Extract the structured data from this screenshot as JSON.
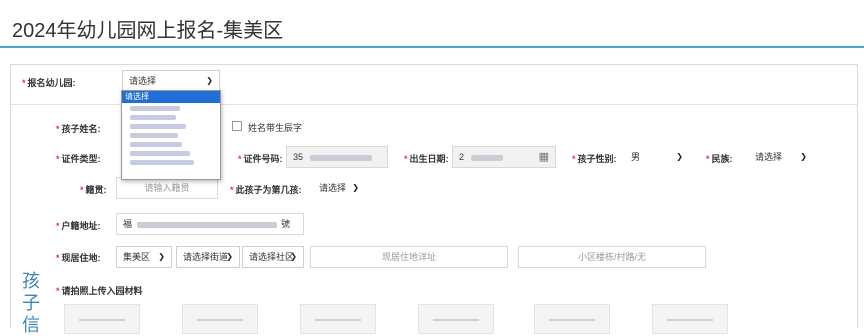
{
  "page": {
    "title": "2024年幼儿园网上报名-集美区"
  },
  "kindergarten": {
    "label": "报名幼儿园:",
    "required": "*",
    "select_value": "请选择",
    "options": [
      "请选择"
    ]
  },
  "child": {
    "section_label": "孩子信",
    "name": {
      "label": "孩子姓名:",
      "required": "*",
      "unborn_label": "姓名带生辰字"
    },
    "id_type": {
      "label": "证件类型:",
      "required": "*"
    },
    "id_number": {
      "label": "证件号码:",
      "required": "*",
      "value_prefix": "35"
    },
    "birth_date": {
      "label": "出生日期:",
      "required": "*",
      "value_prefix": "2"
    },
    "gender": {
      "label": "孩子性别:",
      "required": "*",
      "value": "男"
    },
    "ethnicity": {
      "label": "民族:",
      "required": "*",
      "value": "请选择"
    },
    "native_place": {
      "label": "籍贯:",
      "required": "*",
      "placeholder": "请输入籍贯"
    },
    "child_order": {
      "label": "此孩子为第几孩:",
      "required": "*",
      "value": "请选择"
    },
    "household_address": {
      "label": "户籍地址:",
      "required": "*",
      "value_prefix": "福",
      "value_suffix": "號"
    },
    "residence": {
      "label": "现居住地:",
      "required": "*",
      "district": "集美区",
      "street": "请选择街道",
      "community": "请选择社区",
      "detail_placeholder": "现居住地详址",
      "building_placeholder": "小区楼栋/村路/无"
    },
    "upload": {
      "label": "请拍照上传入园材料",
      "required": "*"
    }
  },
  "icons": {
    "chevron": "chevron-down-icon",
    "calendar": "calendar-icon"
  },
  "colors": {
    "accent": "#4ba3d6",
    "required": "#e03c3c",
    "dropdown_selected": "#1f6fd6",
    "section_label": "#3d84b8"
  }
}
